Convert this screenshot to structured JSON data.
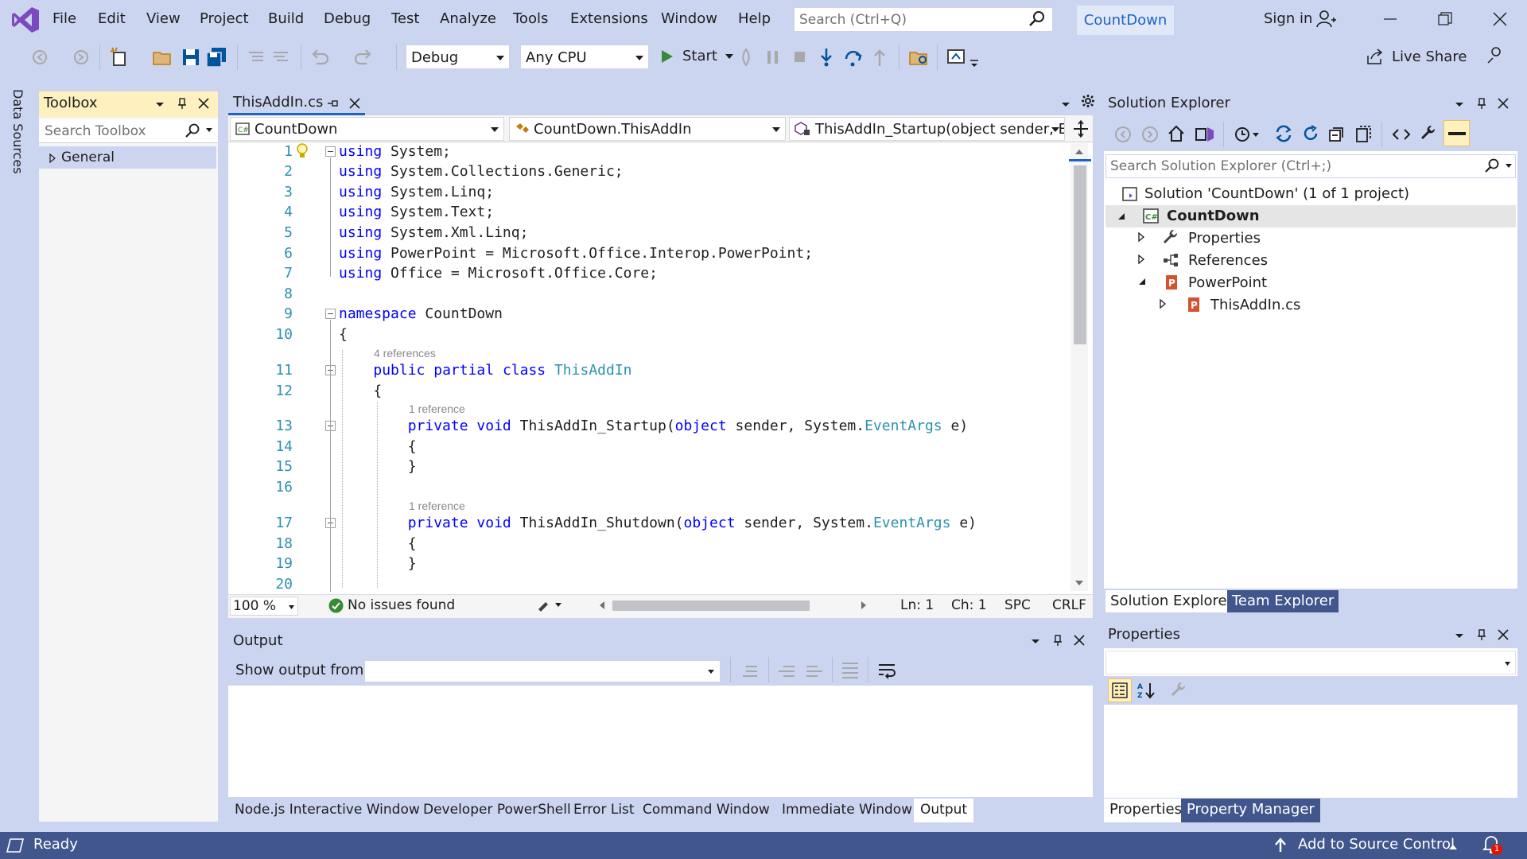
{
  "menubar": {
    "items": [
      "File",
      "Edit",
      "View",
      "Project",
      "Build",
      "Debug",
      "Test",
      "Analyze",
      "Tools",
      "Extensions",
      "Window",
      "Help"
    ],
    "search_placeholder": "Search (Ctrl+Q)",
    "solution_badge": "CountDown",
    "sign_in": "Sign in"
  },
  "toolbar": {
    "config": "Debug",
    "platform": "Any CPU",
    "start": "Start",
    "live_share": "Live Share"
  },
  "side_strip": {
    "label": "Data Sources"
  },
  "toolbox": {
    "title": "Toolbox",
    "search_placeholder": "Search Toolbox",
    "group": "General"
  },
  "editor": {
    "tab": "ThisAddIn.cs",
    "nav": {
      "project": "CountDown",
      "type": "CountDown.ThisAddIn",
      "member": "ThisAddIn_Startup(object sender, Eve"
    },
    "lens": {
      "class_refs": "4 references",
      "startup_refs": "1 reference",
      "shutdown_refs": "1 reference"
    },
    "status": {
      "zoom": "100 %",
      "issues": "No issues found",
      "ln": "Ln: 1",
      "ch": "Ch: 1",
      "spc": "SPC",
      "crlf": "CRLF"
    }
  },
  "output": {
    "title": "Output",
    "show_from": "Show output from:",
    "source": ""
  },
  "bottom_tabs": [
    "Node.js Interactive Window",
    "Developer PowerShell",
    "Error List",
    "Command Window",
    "Immediate Window",
    "Output"
  ],
  "solution_explorer": {
    "title": "Solution Explorer",
    "search_placeholder": "Search Solution Explorer (Ctrl+;)",
    "solution": "Solution 'CountDown' (1 of 1 project)",
    "project": "CountDown",
    "properties": "Properties",
    "references": "References",
    "folder": "PowerPoint",
    "file": "ThisAddIn.cs",
    "tabs": [
      "Solution Explorer",
      "Team Explorer"
    ]
  },
  "properties": {
    "title": "Properties",
    "tabs": [
      "Properties",
      "Property Manager"
    ]
  },
  "statusbar": {
    "ready": "Ready",
    "source_control": "Add to Source Control",
    "notifications": "1"
  },
  "colors": {
    "accent": "#1E62C8",
    "chrome": "#CCD5F0",
    "statusbar": "#40568D",
    "keyword": "#0000FF",
    "type": "#2B91AF"
  }
}
